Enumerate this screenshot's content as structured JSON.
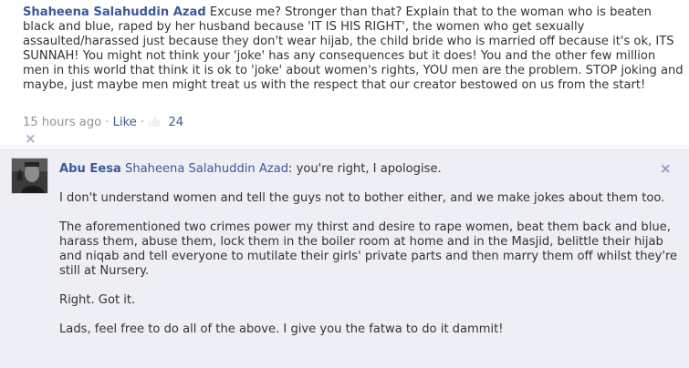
{
  "comment1": {
    "author": "Shaheena Salahuddin Azad",
    "text": "Excuse me? Stronger than that? Explain that to the woman who is beaten black and blue, raped by her husband because 'IT IS HIS RIGHT', the women who get sexually assaulted/harassed just because they don't wear hijab, the child bride who is married off because it's ok, ITS SUNNAH! You might not think your 'joke' has any consequences but it does! You and the other few million men in this world that think it is ok to 'joke' about women's rights, YOU men are the problem. STOP joking and maybe, just maybe men might treat us with the respect that our creator bestowed on us from the start!",
    "timestamp": "15 hours ago",
    "separator": "·",
    "like_label": "Like",
    "like_count": "24",
    "remove_glyph": "×"
  },
  "comment2": {
    "author": "Abu Eesa",
    "mention": "Shaheena Salahuddin Azad",
    "first_line": ": you're right, I apologise.",
    "paragraphs": [
      "I don't understand women and tell the guys not to bother either, and we make jokes about them too.",
      "The aforementioned two crimes power my thirst and desire to rape women, beat them back and blue, harass them, abuse them, lock them in the boiler room at home and in the Masjid, belittle their hijab and niqab and tell everyone to mutilate their girls' private parts and then marry them off whilst they're still at Nursery.",
      "Right. Got it.",
      "Lads, feel free to do all of the above. I give you the fatwa to do it dammit!"
    ],
    "remove_glyph": "×"
  }
}
